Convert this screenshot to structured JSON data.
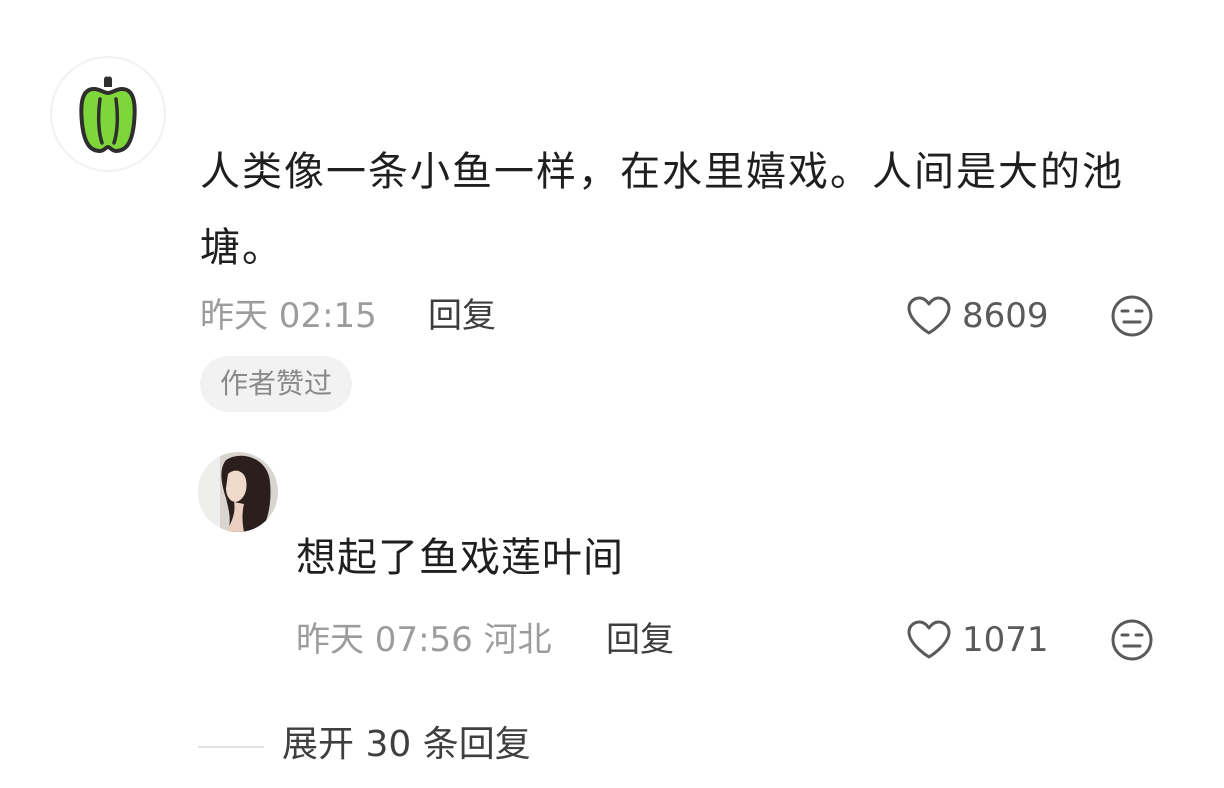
{
  "comment": {
    "text": "人类像一条小鱼一样，在水里嬉戏。人间是大的池塘。",
    "time": "昨天 02:15",
    "reply_label": "回复",
    "like_count": "8609",
    "author_liked_badge": "作者赞过"
  },
  "reply": {
    "text": "想起了鱼戏莲叶间",
    "time_location": "昨天 07:56 河北",
    "reply_label": "回复",
    "like_count": "1071"
  },
  "expand": {
    "label": "展开 30 条回复"
  },
  "icons": {
    "avatar_main": "green-pepper-icon",
    "like": "heart-outline-icon",
    "dislike": "meh-face-icon"
  },
  "colors": {
    "pepper_green": "#7ed63a",
    "text_primary": "#1f1f1f",
    "text_secondary": "#9c9c9c"
  }
}
